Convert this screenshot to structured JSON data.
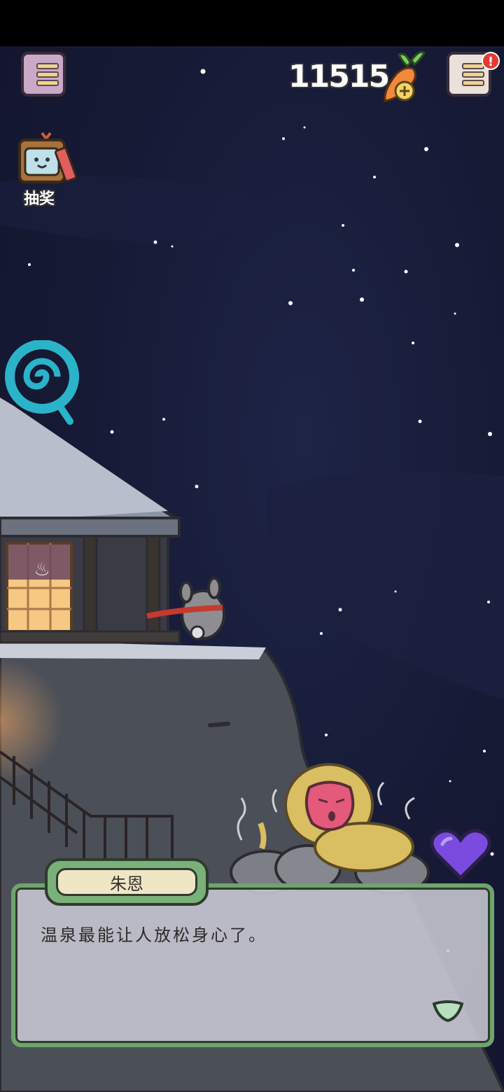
{
  "hud": {
    "currency_amount": "11515",
    "currency_icon": "carrot-plus-icon",
    "menu_left_icon": "menu-icon",
    "menu_right_icon": "menu-notify-icon",
    "notification_badge": "!",
    "lottery_label": "抽奖"
  },
  "dialog": {
    "speaker": "朱恩",
    "text": "温泉最能让人放松身心了。"
  },
  "colors": {
    "sky": "#161a35",
    "dialog_border": "#6ea46d",
    "heart": "#7b4be0",
    "swirl": "#2ab3c9"
  }
}
